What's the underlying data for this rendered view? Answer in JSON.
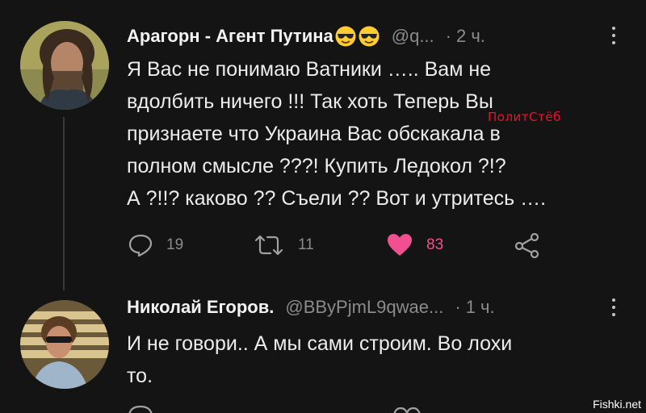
{
  "tweets": [
    {
      "author": "Арагорн - Агент Путина",
      "emojis": [
        "smiling-face-with-sunglasses",
        "smiling-face-with-sunglasses"
      ],
      "handle": "@q...",
      "separator": "·",
      "time": "2 ч.",
      "lines": [
        "Я Вас не понимаю Ватники ….. Вам не",
        "вдолбить ничего !!! Так хоть Теперь Вы",
        "признаете что Украина Вас обскакала в",
        "полном смысле ???! Купить Ледокол ?!?",
        "А ?!!? каково ?? Съели ?? Вот и утритесь …."
      ],
      "actions": {
        "replies": "19",
        "retweets": "11",
        "likes": "83"
      }
    },
    {
      "author": "Николай Егоров.",
      "handle": "@BByPjmL9qwae...",
      "separator": "·",
      "time": "1 ч.",
      "lines": [
        "И не говори.. А мы сами строим. Во лохи",
        "то."
      ]
    }
  ],
  "watermark": "ПолитСтёб",
  "site_credit": "Fishki.net",
  "colors": {
    "background": "#141414",
    "text": "#ececec",
    "muted": "#8b8b8b",
    "like": "#f0508f",
    "watermark": "#e8132f"
  }
}
